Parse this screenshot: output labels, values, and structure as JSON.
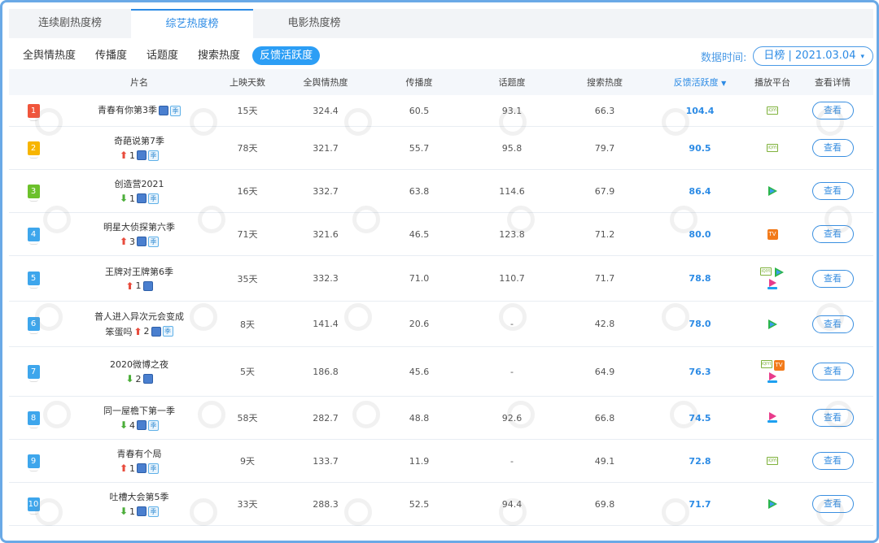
{
  "tabs": [
    {
      "label": "连续剧热度榜",
      "active": false
    },
    {
      "label": "综艺热度榜",
      "active": true
    },
    {
      "label": "电影热度榜",
      "active": false
    }
  ],
  "subtabs": [
    {
      "label": "全舆情热度",
      "active": false
    },
    {
      "label": "传播度",
      "active": false
    },
    {
      "label": "话题度",
      "active": false
    },
    {
      "label": "搜索热度",
      "active": false
    },
    {
      "label": "反馈活跃度",
      "active": true
    }
  ],
  "date": {
    "label": "数据时间:",
    "value": "日榜 | 2021.03.04"
  },
  "headers": {
    "name": "片名",
    "days": "上映天数",
    "all": "全舆情热度",
    "prop": "传播度",
    "topic": "话题度",
    "search": "搜索热度",
    "fb": "反馈活跃度",
    "plat": "播放平台",
    "view": "查看详情"
  },
  "view_label": "查看",
  "colors": {
    "accent": "#2c8be5",
    "up": "#e84c3d",
    "down": "#4cae3a"
  },
  "rows": [
    {
      "rank": "1",
      "rank_color": "#f0553c",
      "title": "青春有你第3季",
      "trend": "",
      "trend_num": "",
      "tags": [
        "zong",
        "ji"
      ],
      "inline": true,
      "days": "15天",
      "all": "324.4",
      "prop": "60.5",
      "topic": "93.1",
      "search": "66.3",
      "fb": "104.4",
      "platforms": [
        "iqiyi"
      ]
    },
    {
      "rank": "2",
      "rank_color": "#f7b500",
      "title": "奇葩说第7季",
      "trend": "up",
      "trend_num": "1",
      "tags": [
        "zong",
        "ji"
      ],
      "days": "78天",
      "all": "321.7",
      "prop": "55.7",
      "topic": "95.8",
      "search": "79.7",
      "fb": "90.5",
      "platforms": [
        "iqiyi"
      ]
    },
    {
      "rank": "3",
      "rank_color": "#6cc12b",
      "title": "创造营2021",
      "trend": "down",
      "trend_num": "1",
      "tags": [
        "zong",
        "ji"
      ],
      "days": "16天",
      "all": "332.7",
      "prop": "63.8",
      "topic": "114.6",
      "search": "67.9",
      "fb": "86.4",
      "platforms": [
        "tencent"
      ]
    },
    {
      "rank": "4",
      "rank_color": "#3ea6ec",
      "title": "明星大侦探第六季",
      "trend": "up",
      "trend_num": "3",
      "tags": [
        "zong",
        "ji"
      ],
      "days": "71天",
      "all": "321.6",
      "prop": "46.5",
      "topic": "123.8",
      "search": "71.2",
      "fb": "80.0",
      "platforms": [
        "mango"
      ]
    },
    {
      "rank": "5",
      "rank_color": "#3ea6ec",
      "title": "王牌对王牌第6季",
      "trend": "up",
      "trend_num": "1",
      "tags": [
        "zong"
      ],
      "days": "35天",
      "all": "332.3",
      "prop": "71.0",
      "topic": "110.7",
      "search": "71.7",
      "fb": "78.8",
      "platforms": [
        "iqiyi",
        "tencent",
        "youku"
      ]
    },
    {
      "rank": "6",
      "rank_color": "#3ea6ec",
      "title": "普人进入异次元会变成",
      "title2": "笨蛋吗",
      "trend": "up",
      "trend_num": "2",
      "tags": [
        "zong",
        "ji"
      ],
      "days": "8天",
      "all": "141.4",
      "prop": "20.6",
      "topic": "-",
      "search": "42.8",
      "fb": "78.0",
      "platforms": [
        "tencent"
      ]
    },
    {
      "rank": "7",
      "rank_color": "#3ea6ec",
      "title": "2020微博之夜",
      "trend": "down",
      "trend_num": "2",
      "tags": [
        "zong"
      ],
      "days": "5天",
      "all": "186.8",
      "prop": "45.6",
      "topic": "-",
      "search": "64.9",
      "fb": "76.3",
      "platforms": [
        "iqiyi",
        "mango",
        "youku"
      ]
    },
    {
      "rank": "8",
      "rank_color": "#3ea6ec",
      "title": "同一屋檐下第一季",
      "trend": "down",
      "trend_num": "4",
      "tags": [
        "zong",
        "ji"
      ],
      "days": "58天",
      "all": "282.7",
      "prop": "48.8",
      "topic": "92.6",
      "search": "66.8",
      "fb": "74.5",
      "platforms": [
        "youku"
      ]
    },
    {
      "rank": "9",
      "rank_color": "#3ea6ec",
      "title": "青春有个局",
      "trend": "up",
      "trend_num": "1",
      "tags": [
        "zong",
        "ji"
      ],
      "days": "9天",
      "all": "133.7",
      "prop": "11.9",
      "topic": "-",
      "search": "49.1",
      "fb": "72.8",
      "platforms": [
        "iqiyi"
      ]
    },
    {
      "rank": "10",
      "rank_color": "#3ea6ec",
      "title": "吐槽大会第5季",
      "trend": "down",
      "trend_num": "1",
      "tags": [
        "zong",
        "ji"
      ],
      "days": "33天",
      "all": "288.3",
      "prop": "52.5",
      "topic": "94.4",
      "search": "69.8",
      "fb": "71.7",
      "platforms": [
        "tencent"
      ]
    }
  ],
  "tag_ji_label": "季",
  "platform_labels": {
    "iqiyi": "iQIYI",
    "mango": "TV"
  }
}
